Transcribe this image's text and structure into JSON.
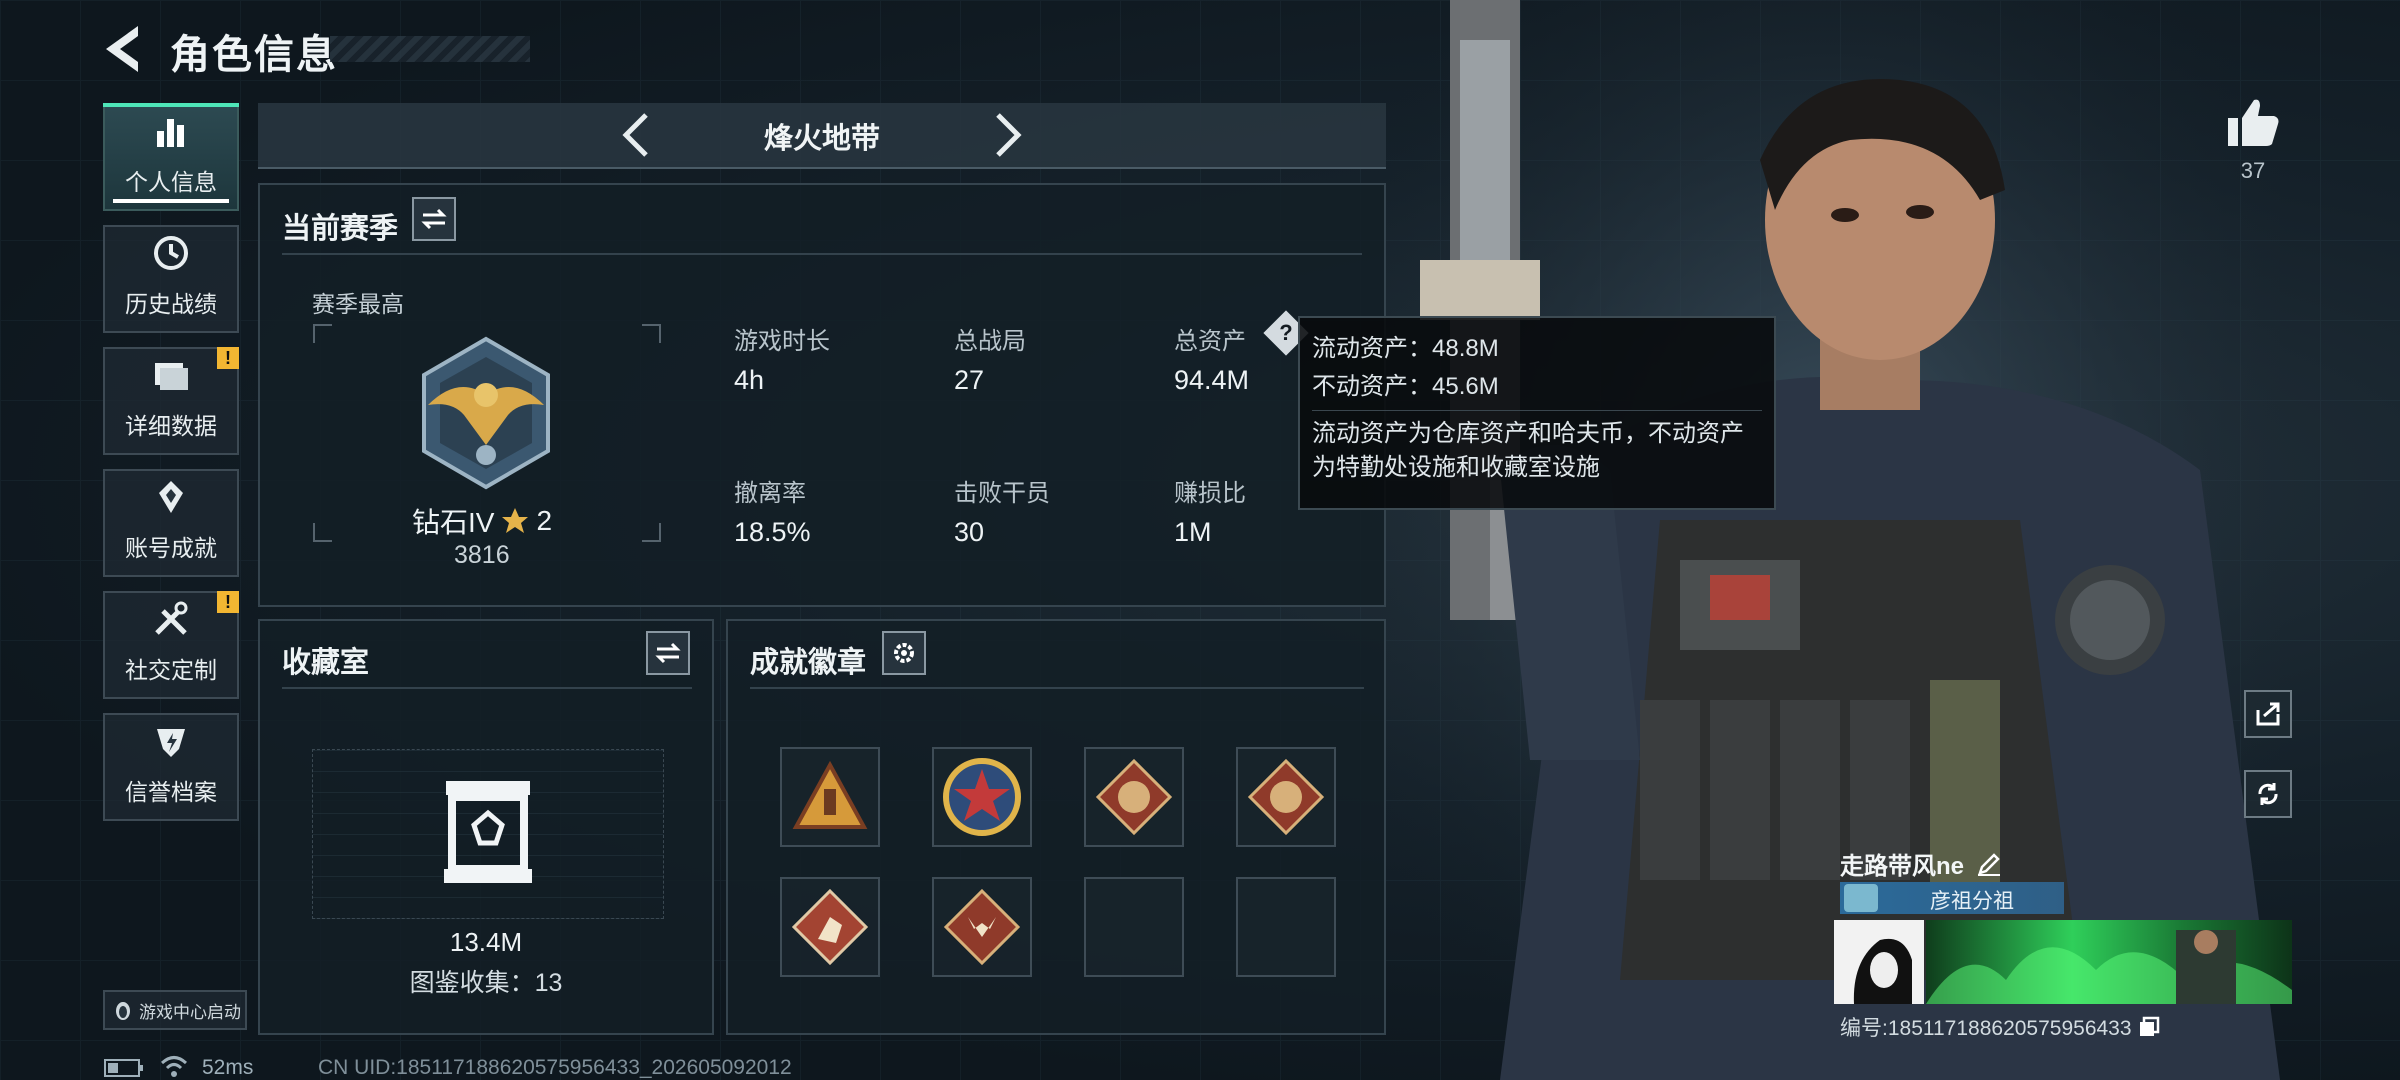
{
  "header": {
    "title": "角色信息"
  },
  "nav": {
    "items": [
      {
        "label": "个人信息",
        "active": true,
        "icon": "bar-chart-icon",
        "alert": false
      },
      {
        "label": "历史战绩",
        "active": false,
        "icon": "history-clock-icon",
        "alert": false
      },
      {
        "label": "详细数据",
        "active": false,
        "icon": "folder-icon",
        "alert": true
      },
      {
        "label": "账号成就",
        "active": false,
        "icon": "diamond-medal-icon",
        "alert": false
      },
      {
        "label": "社交定制",
        "active": false,
        "icon": "wrench-screwdriver-icon",
        "alert": true
      },
      {
        "label": "信誉档案",
        "active": false,
        "icon": "shield-credit-icon",
        "alert": false
      }
    ],
    "alert_mark": "!"
  },
  "mode": {
    "title": "烽火地带"
  },
  "season": {
    "title": "当前赛季",
    "best_label": "赛季最高",
    "rank_name": "钻石IV",
    "rank_stars": "2",
    "rank_score": "3816",
    "stats": [
      {
        "label": "游戏时长",
        "value": "4h"
      },
      {
        "label": "总战局",
        "value": "27"
      },
      {
        "label": "总资产",
        "value": "94.4M"
      },
      {
        "label": "撤离率",
        "value": "18.5%"
      },
      {
        "label": "击败干员",
        "value": "30"
      },
      {
        "label": "赚损比",
        "value": "1M"
      }
    ]
  },
  "tooltip": {
    "line1": "流动资产：48.8M",
    "line2": "不动资产：45.6M",
    "line3": "流动资产为仓库资产和哈夫币，不动资产",
    "line4": "为特勤处设施和收藏室设施"
  },
  "collection": {
    "title": "收藏室",
    "value": "13.4M",
    "count_label": "图鉴收集：13"
  },
  "achievements": {
    "title": "成就徽章"
  },
  "character": {
    "likes": "37",
    "name": "走路带风ne",
    "group": "彦祖分祖",
    "id_label": "编号:185117188620575956433"
  },
  "footer": {
    "launch": "游戏中心启动",
    "ping": "52ms",
    "uid": "CN UID:185117188620575956433_202605092012"
  },
  "colors": {
    "accent": "#4ee6b8",
    "alert": "#f2b632",
    "gold": "#e5b34a"
  }
}
